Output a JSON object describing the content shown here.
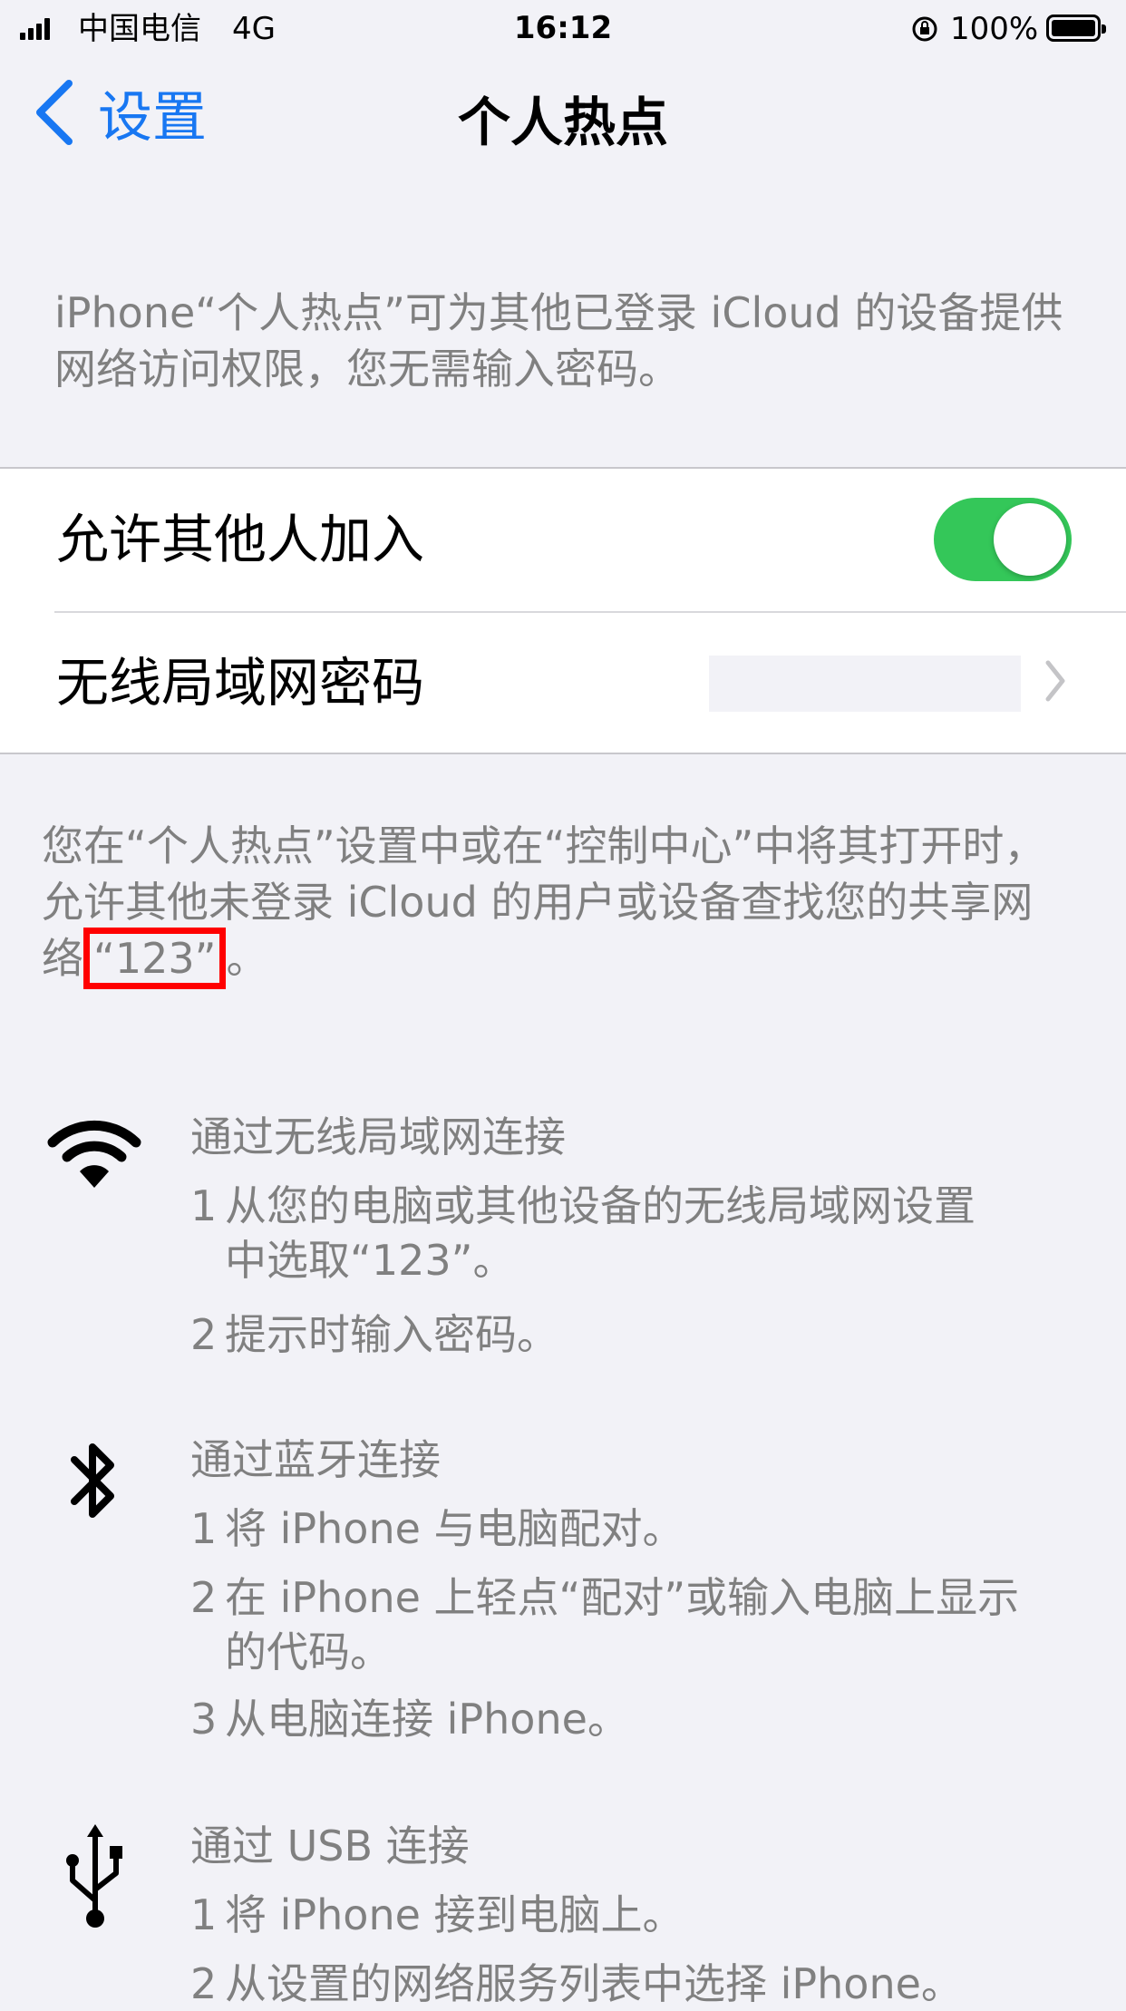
{
  "status_bar": {
    "carrier": "中国电信",
    "network": "4G",
    "time": "16:12",
    "battery_percent": "100%"
  },
  "nav": {
    "back_label": "设置",
    "title": "个人热点"
  },
  "header_text": "iPhone“个人热点”可为其他已登录 iCloud 的设备提供网络访问权限，您无需输入密码。",
  "settings": {
    "allow_others_label": "允许其他人加入",
    "allow_others_on": true,
    "wifi_password_label": "无线局域网密码",
    "wifi_password_value": ""
  },
  "footer_text": {
    "before": "您在“个人热点”设置中或在“控制中心”中将其打开时，允许其他未登录 iCloud 的用户或设备查找您的共享网络",
    "network_name": "“123”",
    "after": "。"
  },
  "sections": {
    "wifi": {
      "icon": "wifi-icon",
      "title": "通过无线局域网连接",
      "steps": [
        {
          "num": "1",
          "line1": "从您的电脑或其他设备的无线局域网设置",
          "line2": "中选取“123”。"
        },
        {
          "num": "2",
          "line1": "提示时输入密码。",
          "line2": ""
        }
      ]
    },
    "bluetooth": {
      "icon": "bluetooth-icon",
      "title": "通过蓝牙连接",
      "steps": [
        {
          "num": "1",
          "line1": "将 iPhone 与电脑配对。",
          "line2": ""
        },
        {
          "num": "2",
          "line1": "在 iPhone 上轻点“配对”或输入电脑上显示",
          "line2": "的代码。"
        },
        {
          "num": "3",
          "line1": "从电脑连接 iPhone。",
          "line2": ""
        }
      ]
    },
    "usb": {
      "icon": "usb-icon",
      "title": "通过 USB 连接",
      "steps": [
        {
          "num": "1",
          "line1": "将 iPhone 接到电脑上。",
          "line2": ""
        },
        {
          "num": "2",
          "line1": "从设置的网络服务列表中选择 iPhone。",
          "line2": ""
        }
      ]
    }
  }
}
